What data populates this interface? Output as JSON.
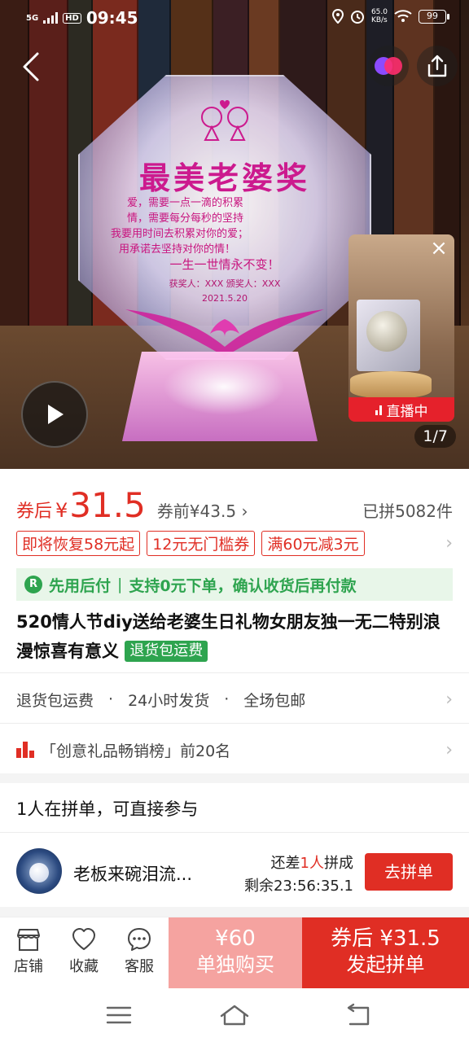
{
  "status_bar": {
    "network": "5G",
    "hd": "HD",
    "time": "09:45",
    "speed": "65.0",
    "speed_unit": "KB/s",
    "battery": "99"
  },
  "hero": {
    "award_title": "最美老婆奖",
    "verse_lines": [
      "爱，需要一点一滴的积累",
      "情，需要每分每秒的坚持",
      "我要用时间去积累对你的爱；",
      "用承诺去坚持对你的情！",
      "一生一世情永不变！"
    ],
    "award_meta": "获奖人：XXX   颁奖人：XXX",
    "award_date": "2021.5.20",
    "page_counter": "1/7",
    "live_label": "直播中"
  },
  "price": {
    "prefix": "券后",
    "currency": "¥",
    "value": "31.5",
    "before": "券前¥43.5",
    "sold": "已拼5082件"
  },
  "coupons": [
    "即将恢复58元起",
    "12元无门槛券",
    "满60元减3元"
  ],
  "pay_later": {
    "icon_letter": "R",
    "label": "先用后付",
    "separator": "|",
    "desc": "支持0元下单，确认收货后再付款"
  },
  "product": {
    "title": "520情人节diy送给老婆生日礼物女朋友独一无二特别浪漫惊喜有意义",
    "tag": "退货包运费"
  },
  "services": [
    "退货包运费",
    "24小时发货",
    "全场包邮"
  ],
  "service_dot": "·",
  "rank": {
    "text": "「创意礼品畅销榜」前20名"
  },
  "group_section": {
    "header": "1人在拼单，可直接参与",
    "user_name": "老板来碗泪流...",
    "need_prefix": "还差",
    "need_count": "1人",
    "need_suffix": "拼成",
    "remaining": "剩余23:56:35.1",
    "join_label": "去拼单"
  },
  "action_bar": {
    "shop_label": "店铺",
    "favorite_label": "收藏",
    "service_label": "客服",
    "solo_price": "¥60",
    "solo_label": "单独购买",
    "group_price": "券后 ¥31.5",
    "group_label": "发起拼单"
  },
  "colors": {
    "accent_red": "#e02e24",
    "green": "#2ea44f",
    "solo_pink": "#f5a3a0",
    "award_magenta": "#cc1a8e"
  },
  "icons": {
    "back": "chevron-left-icon",
    "share": "share-icon",
    "app_logo": "app-logo-icon",
    "play": "play-icon",
    "close": "close-icon",
    "shop": "shop-icon",
    "favorite": "heart-icon",
    "service": "chat-icon",
    "menu": "menu-icon",
    "home": "home-icon",
    "back_nav": "back-nav-icon"
  }
}
